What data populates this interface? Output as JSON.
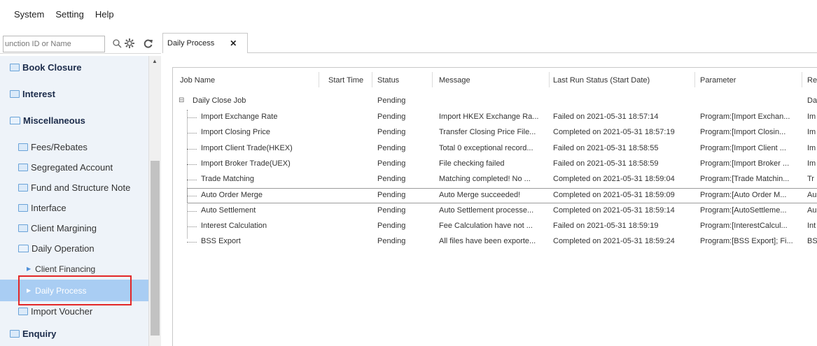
{
  "menu": [
    "System",
    "Setting",
    "Help"
  ],
  "search": {
    "placeholder": "unction ID or Name"
  },
  "sidebar": {
    "items": [
      {
        "label": "Book Closure",
        "level": "top"
      },
      {
        "label": "Interest",
        "level": "top"
      },
      {
        "label": "Miscellaneous",
        "level": "top-folder"
      },
      {
        "label": "Fees/Rebates",
        "level": "sub"
      },
      {
        "label": "Segregated Account",
        "level": "sub"
      },
      {
        "label": "Fund and Structure Note",
        "level": "sub"
      },
      {
        "label": "Interface",
        "level": "sub"
      },
      {
        "label": "Client Margining",
        "level": "sub"
      },
      {
        "label": "Daily Operation",
        "level": "sub-folder"
      },
      {
        "label": "Client Financing",
        "level": "leaf"
      },
      {
        "label": "Daily Process",
        "level": "leaf",
        "selected": true
      },
      {
        "label": "Import Voucher",
        "level": "sub"
      },
      {
        "label": "Enquiry",
        "level": "top"
      }
    ]
  },
  "tab": {
    "label": "Daily Process",
    "close": "✕"
  },
  "grid": {
    "columns": [
      "Job Name",
      "Start Time",
      "Status",
      "Message",
      "Last Run Status (Start Date)",
      "Parameter",
      "Re"
    ],
    "root": {
      "expander": "⊟",
      "name": "Daily Close Job",
      "status": "Pending",
      "remark": "Da"
    },
    "rows": [
      {
        "name": "Import Exchange Rate",
        "status": "Pending",
        "message": "Import HKEX Exchange Ra...",
        "last": "Failed on 2021-05-31 18:57:14",
        "param": "Program:[Import Exchan...",
        "remark": "Im"
      },
      {
        "name": "Import Closing Price",
        "status": "Pending",
        "message": "Transfer Closing Price File...",
        "last": "Completed on 2021-05-31 18:57:19",
        "param": "Program:[Import Closin...",
        "remark": "Im"
      },
      {
        "name": "Import Client Trade(HKEX)",
        "status": "Pending",
        "message": "Total 0 exceptional record...",
        "last": "Failed on 2021-05-31 18:58:55",
        "param": "Program:[Import Client ...",
        "remark": "Im"
      },
      {
        "name": "Import Broker Trade(UEX)",
        "status": "Pending",
        "message": "File checking failed",
        "last": "Failed on 2021-05-31 18:58:59",
        "param": "Program:[Import Broker ...",
        "remark": "Im"
      },
      {
        "name": "Trade Matching",
        "status": "Pending",
        "message": "Matching completed! No ...",
        "last": "Completed on 2021-05-31 18:59:04",
        "param": "Program:[Trade Matchin...",
        "remark": "Tr"
      },
      {
        "name": "Auto Order Merge",
        "status": "Pending",
        "message": "Auto Merge succeeded!",
        "last": "Completed on 2021-05-31 18:59:09",
        "param": "Program:[Auto Order M...",
        "remark": "Au"
      },
      {
        "name": "Auto Settlement",
        "status": "Pending",
        "message": "Auto Settlement processe...",
        "last": "Completed on 2021-05-31 18:59:14",
        "param": "Program:[AutoSettleme...",
        "remark": "Au"
      },
      {
        "name": "Interest Calculation",
        "status": "Pending",
        "message": "Fee Calculation have not ...",
        "last": "Failed on 2021-05-31 18:59:19",
        "param": "Program:[InterestCalcul...",
        "remark": "Int"
      },
      {
        "name": "BSS Export",
        "status": "Pending",
        "message": "All files have been exporte...",
        "last": "Completed on 2021-05-31 18:59:24",
        "param": "Program:[BSS Export]; Fi...",
        "remark": "BS"
      }
    ]
  },
  "colors": {
    "selected": "#a9cdf3",
    "highlight": "#e32727",
    "treeBg": "#eef3f9"
  }
}
